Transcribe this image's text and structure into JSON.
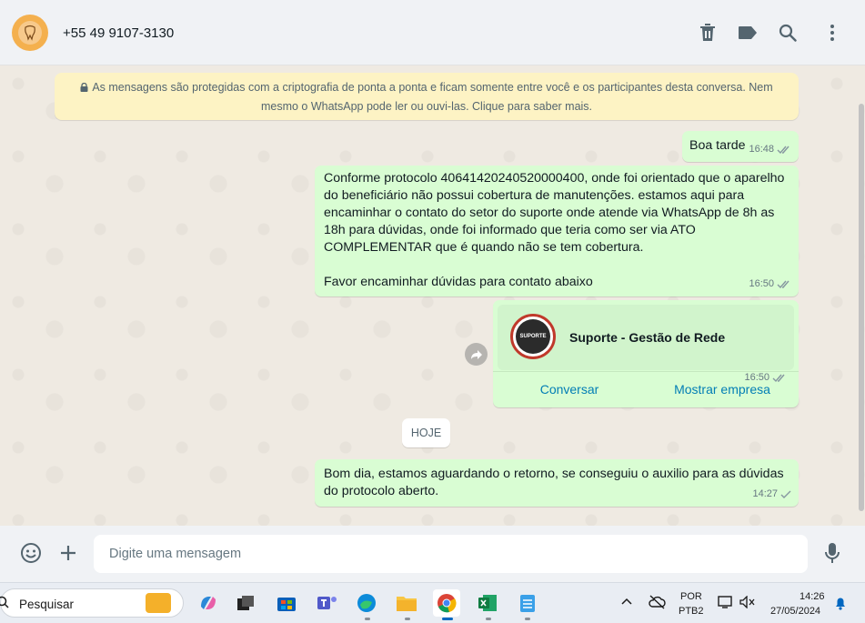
{
  "header": {
    "contact_name": "+55 49 9107-3130",
    "icons": [
      "delete-icon",
      "label-icon",
      "search-icon",
      "menu-icon"
    ]
  },
  "encryption_notice": {
    "line1": "As mensagens são protegidas com a criptografia de ponta a ponta e ficam somente entre você e os participantes desta conversa. Nem",
    "line2": "mesmo o WhatsApp pode ler ou ouvi-las. Clique para saber mais."
  },
  "messages": [
    {
      "text": "Boa tarde",
      "time": "16:48",
      "status": "read"
    },
    {
      "text": "Conforme protocolo 40641420240520000400, onde foi orientado que o aparelho\ndo beneficiário não possui cobertura de manutenções. estamos aqui para\nencaminhar o contato do setor do suporte onde atende via WhatsApp de 8h as\n18h para dúvidas, onde foi informado que teria como ser via ATO\nCOMPLEMENTAR que é quando não se tem cobertura.\n\nFavor encaminhar dúvidas para contato abaixo",
      "time": "16:50",
      "status": "read"
    },
    {
      "type": "contact_card",
      "name": "Suporte - Gestão de Rede",
      "time": "16:50",
      "status": "read",
      "logo_text": "SUPORTE",
      "actions": [
        "Conversar",
        "Mostrar empresa"
      ]
    },
    {
      "text": "Bom dia, estamos aguardando o retorno, se conseguiu o auxilio para as dúvidas\ndo protocolo aberto.",
      "time": "14:27",
      "status": "sent"
    }
  ],
  "date_divider": "HOJE",
  "composer": {
    "placeholder": "Digite uma mensagem"
  },
  "taskbar": {
    "search_label": "Pesquisar",
    "lang_line1": "POR",
    "lang_line2": "PTB2",
    "time": "14:26",
    "date": "27/05/2024"
  },
  "colors": {
    "outgoing_bubble": "#d9fdd3",
    "chat_background": "#efeae2",
    "read_tick": "#53bdeb",
    "link": "#027eb5"
  }
}
